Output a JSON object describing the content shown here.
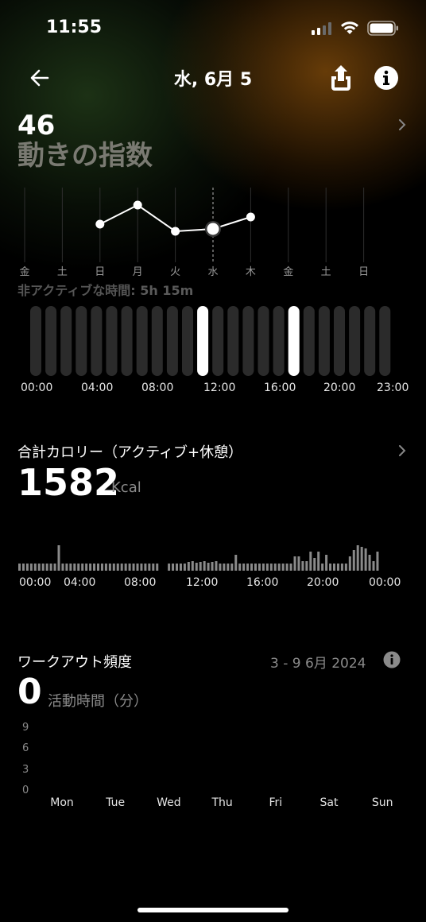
{
  "status": {
    "time": "11:55"
  },
  "header": {
    "title": "水, 6月 5",
    "back_icon": "arrow-left-icon",
    "share_icon": "share-icon",
    "info_icon": "info-icon"
  },
  "movement": {
    "value": "46",
    "label": "動きの指数",
    "weekdays": [
      "金",
      "土",
      "日",
      "月",
      "火",
      "水",
      "木",
      "金",
      "土",
      "日"
    ],
    "points": [
      {
        "day_index": 2,
        "value": 46
      },
      {
        "day_index": 3,
        "value": 54
      },
      {
        "day_index": 4,
        "value": 43
      },
      {
        "day_index": 5,
        "value": 44
      },
      {
        "day_index": 6,
        "value": 49
      }
    ],
    "selected_day_index": 5
  },
  "inactive": {
    "label": "非アクティブな時間:",
    "value": "5h 15m",
    "hour_labels": [
      "00:00",
      "04:00",
      "08:00",
      "12:00",
      "16:00",
      "20:00",
      "23:00"
    ],
    "highlighted_hours": [
      11,
      17
    ]
  },
  "calories": {
    "title": "合計カロリー（アクティブ+休憩）",
    "value": "1582",
    "unit": "Kcal",
    "time_labels": [
      "00:00",
      "04:00",
      "08:00",
      "12:00",
      "16:00",
      "20:00",
      "00:00"
    ]
  },
  "workout": {
    "title": "ワークアウト頻度",
    "date_range": "3 - 9 6月 2024",
    "value": "0",
    "unit": "活動時間（分）",
    "y_ticks": [
      "9",
      "6",
      "3",
      "0"
    ],
    "days": [
      "Mon",
      "Tue",
      "Wed",
      "Thu",
      "Fri",
      "Sat",
      "Sun"
    ]
  },
  "colors": {
    "accent": "#ffffff",
    "bar_dark": "#2b2b2b",
    "bar_highlight": "#ffffff",
    "calorie_bar": "#8a8a8a"
  }
}
